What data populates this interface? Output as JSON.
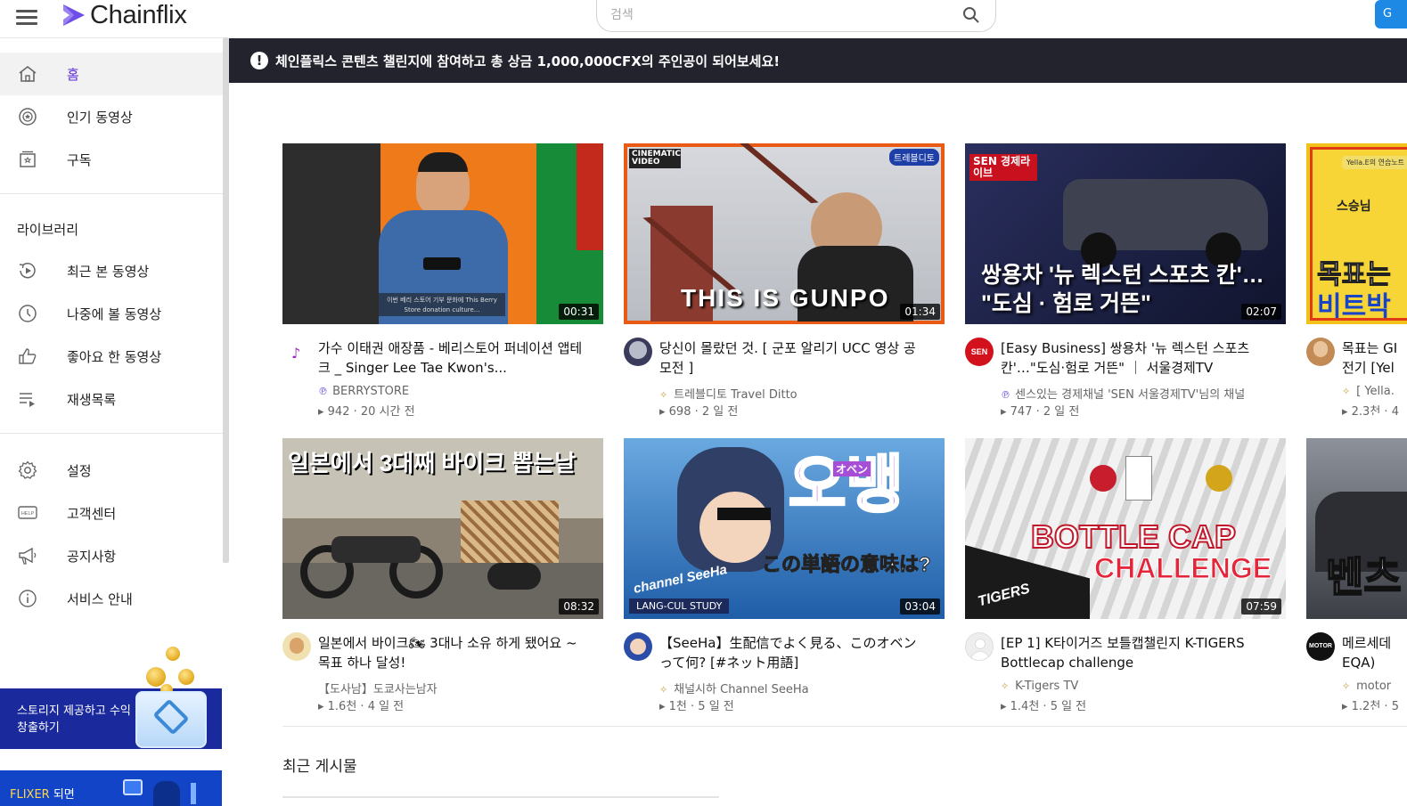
{
  "app": {
    "name": "Chainflix",
    "brand_color": "#5b2bd9"
  },
  "search": {
    "placeholder": "검색"
  },
  "header": {
    "action_label": "G"
  },
  "sidebar": {
    "items": [
      {
        "label": "홈",
        "icon": "home-icon",
        "active": true
      },
      {
        "label": "인기 동영상",
        "icon": "popular-icon"
      },
      {
        "label": "구독",
        "icon": "subscription-icon"
      }
    ],
    "library_title": "라이브러리",
    "library": [
      {
        "label": "최근 본 동영상",
        "icon": "history-icon"
      },
      {
        "label": "나중에 볼 동영상",
        "icon": "clock-icon"
      },
      {
        "label": "좋아요 한 동영상",
        "icon": "thumbs-up-icon"
      },
      {
        "label": "재생목록",
        "icon": "playlist-icon"
      }
    ],
    "settings": [
      {
        "label": "설정",
        "icon": "gear-icon"
      },
      {
        "label": "고객센터",
        "icon": "help-icon"
      },
      {
        "label": "공지사항",
        "icon": "megaphone-icon"
      },
      {
        "label": "서비스 안내",
        "icon": "info-icon"
      }
    ],
    "promo_storage": "스토리지 제공하고 수익창출하기",
    "promo_flixer_highlight": "FLIXER",
    "promo_flixer_rest": " 되면"
  },
  "banner": {
    "icon": "!",
    "text": "체인플릭스 콘텐츠 챌린지에 참여하고 총 상금 1,000,000CFX의 주인공이 되어보세요!"
  },
  "videos": [
    {
      "title": "가수 이태권 애장품 - 베리스토어 퍼네이션 앱테크 _ Singer Lee Tae Kwon's...",
      "channel": "BERRYSTORE",
      "channel_mark": "℗",
      "meta": "▸ 942 · 20 시간 전",
      "duration": "00:31",
      "thumb_caption": "이번 베리 스토어 기부 문화에 This Berry Store donation culture..."
    },
    {
      "title": "당신이 몰랐던 것. [ 군포 알리기 UCC 영상 공모전 ]",
      "channel": "트레블디토 Travel Ditto",
      "channel_mark": "✧",
      "meta": "▸ 698 · 2 일 전",
      "duration": "01:34",
      "thumb_text": "THIS IS GUNPO",
      "thumb_badge1": "CINEMATIC VIDEO",
      "thumb_badge2": "트레블디토"
    },
    {
      "title": "[Easy Business] 쌍용차 '뉴 렉스턴 스포츠 칸'…\"도심·험로 거뜬\" ｜ 서울경제TV",
      "channel": "센스있는 경제채널 'SEN 서울경제TV'님의 채널",
      "channel_mark": "℗",
      "meta": "▸ 747 · 2 일 전",
      "duration": "02:07",
      "thumb_line1": "쌍용차 '뉴 렉스턴 스포츠 칸'…",
      "thumb_line2": "\"도심 · 험로 거뜬\"",
      "thumb_badge": "SEN 경제라이브"
    },
    {
      "title": "목표는 GI 전기 [Yel",
      "channel": "[ Yella.",
      "channel_mark": "✧",
      "meta": "▸ 2.3천 · 4",
      "thumb_text1": "목표는",
      "thumb_text2": "비트박",
      "thumb_small": "스승님"
    },
    {
      "title": "일본에서 바이크🏍 3대나 소유 하게 됐어요 ~목표 하나 달성!",
      "channel": "【도사남】도쿄사는남자",
      "channel_mark": "",
      "meta": "▸ 1.6천 · 4 일 전",
      "duration": "08:32",
      "thumb_text": "일본에서 3대째 바이크 뽑는날"
    },
    {
      "title": "【SeeHa】生配信でよく見る、このオベンって何? [#ネット用語]",
      "channel": "채널시하 Channel SeeHa",
      "channel_mark": "✧",
      "meta": "▸ 1천 · 5 일 전",
      "duration": "03:04",
      "thumb_text": "오뱅",
      "thumb_sub": "この単語の意味は?",
      "thumb_ruby": "オベン",
      "thumb_tag": "LANG-CUL STUDY",
      "thumb_logo": "channel SeeHa"
    },
    {
      "title": "[EP 1] K타이거즈 보틀캡챌린지 K-TIGERS Bottlecap challenge",
      "channel": "K-Tigers TV",
      "channel_mark": "✧",
      "meta": "▸ 1.4천 · 5 일 전",
      "duration": "07:59",
      "thumb_line1": "BOTTLE CAP",
      "thumb_line2": "CHALLENGE",
      "thumb_logo": "TIGERS"
    },
    {
      "title": "메르세데 EQA)",
      "channel": "motor",
      "channel_mark": "✧",
      "meta": "▸ 1.2천 · 5",
      "thumb_text": "벤츠",
      "avatar_text": "MOTOR"
    }
  ],
  "recent_section": {
    "title": "최근 게시물"
  }
}
